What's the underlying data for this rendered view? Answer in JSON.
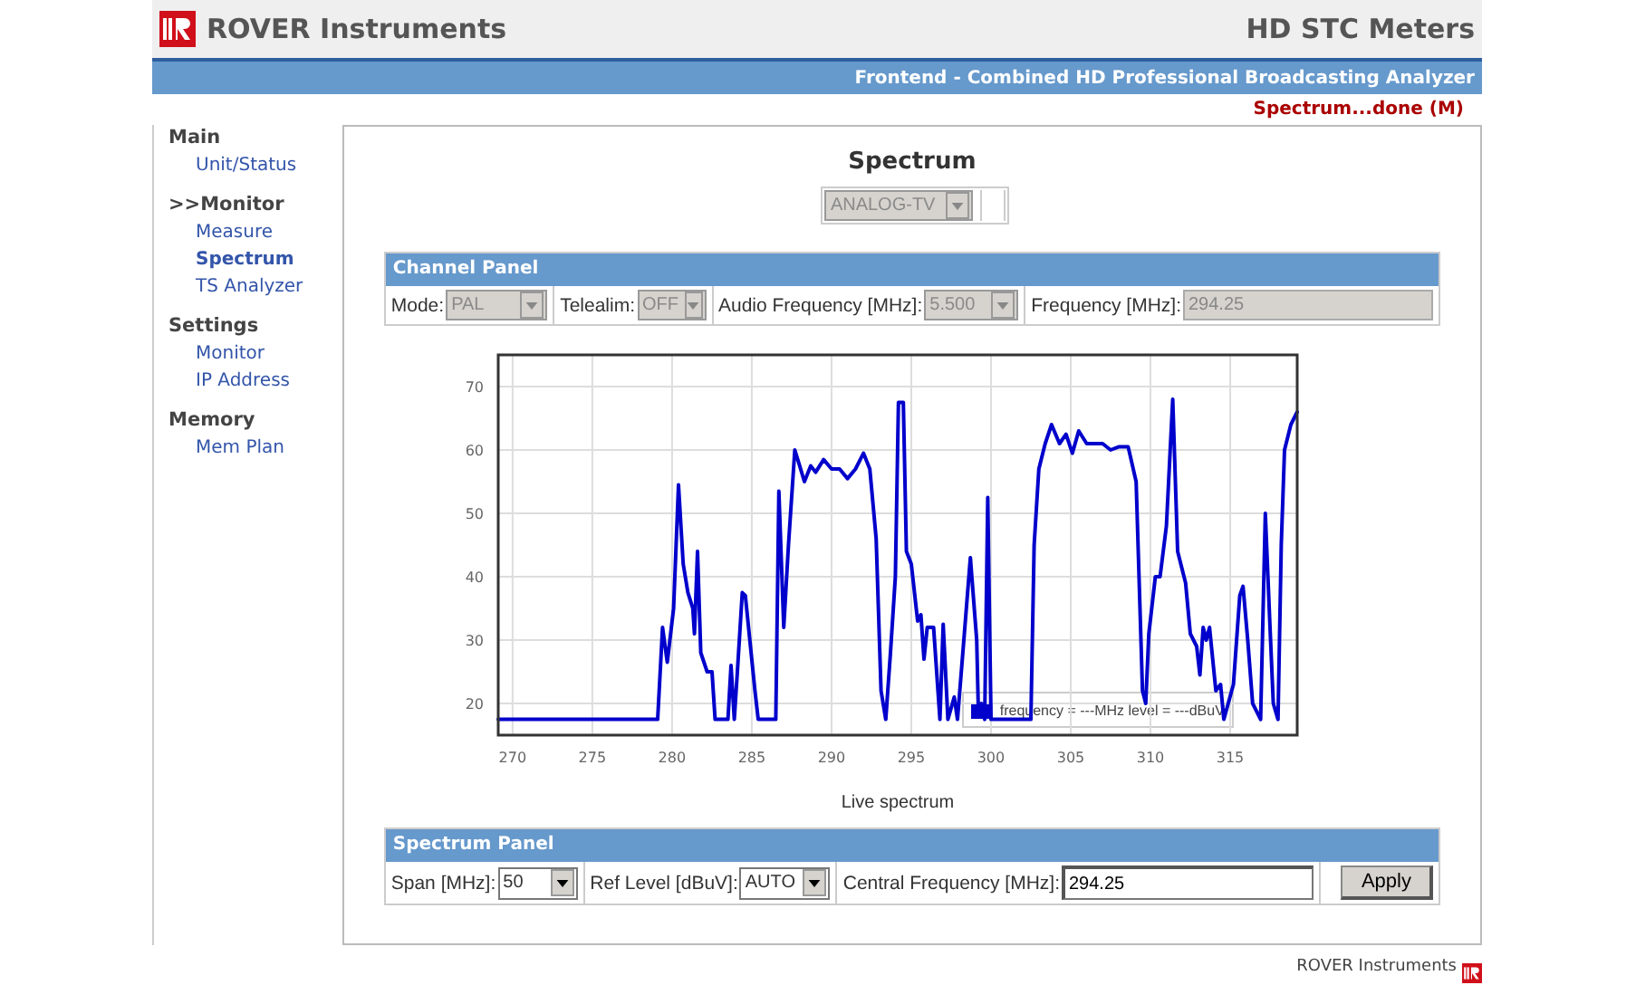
{
  "header": {
    "brand": "ROVER Instruments",
    "product": "HD STC Meters",
    "subtitle": "Frontend - Combined HD Professional Broadcasting Analyzer"
  },
  "status": "Spectrum...done (M)",
  "sidebar": {
    "groups": [
      {
        "title": "Main",
        "items": [
          {
            "label": "Unit/Status",
            "selected": false
          }
        ]
      },
      {
        "title": ">>Monitor",
        "items": [
          {
            "label": "Measure",
            "selected": false
          },
          {
            "label": "Spectrum",
            "selected": true
          },
          {
            "label": "TS Analyzer",
            "selected": false
          }
        ]
      },
      {
        "title": "Settings",
        "items": [
          {
            "label": "Monitor",
            "selected": false
          },
          {
            "label": "IP Address",
            "selected": false
          }
        ]
      },
      {
        "title": "Memory",
        "items": [
          {
            "label": "Mem Plan",
            "selected": false
          }
        ]
      }
    ]
  },
  "page_title": "Spectrum",
  "standard_select": {
    "value": "ANALOG-TV",
    "disabled": true
  },
  "channel_panel": {
    "title": "Channel Panel",
    "fields": [
      {
        "kind": "select",
        "label": "Mode:",
        "value": "PAL",
        "disabled": true
      },
      {
        "kind": "select",
        "label": "Telealim:",
        "value": "OFF",
        "disabled": true
      },
      {
        "kind": "select",
        "label": "Audio Frequency [MHz]:",
        "value": "5.500",
        "disabled": true
      },
      {
        "kind": "input",
        "label": "Frequency [MHz]:",
        "value": "294.25",
        "disabled": true
      }
    ]
  },
  "chart": {
    "chart_data": {
      "type": "line",
      "grid": true,
      "xlabel": "Live spectrum",
      "xlim": [
        269.1,
        319.2
      ],
      "ylim": [
        15,
        75
      ],
      "xticks": [
        270,
        275,
        280,
        285,
        290,
        295,
        300,
        305,
        310,
        315
      ],
      "yticks": [
        20,
        30,
        40,
        50,
        60,
        70
      ],
      "x": [
        269.1,
        279.1,
        279.4,
        279.7,
        280.1,
        280.4,
        280.7,
        281.0,
        281.3,
        281.4,
        281.6,
        281.8,
        282.2,
        282.5,
        282.7,
        283.5,
        283.7,
        283.9,
        284.1,
        284.4,
        284.6,
        285.2,
        285.4,
        286.5,
        286.7,
        287.0,
        287.3,
        287.7,
        288.0,
        288.3,
        288.7,
        289.0,
        289.5,
        290.0,
        290.5,
        291.0,
        291.5,
        292.0,
        292.4,
        292.8,
        293.1,
        293.4,
        293.7,
        294.0,
        294.2,
        294.5,
        294.7,
        295.0,
        295.4,
        295.6,
        295.8,
        296.0,
        296.4,
        296.8,
        297.0,
        297.3,
        297.7,
        297.9,
        298.3,
        298.7,
        299.1,
        299.2,
        299.4,
        299.6,
        299.8,
        300.0,
        302.5,
        302.7,
        303.0,
        303.4,
        303.8,
        304.3,
        304.7,
        305.1,
        305.5,
        306.0,
        306.5,
        307.0,
        307.5,
        308.0,
        308.6,
        309.1,
        309.5,
        309.7,
        309.9,
        310.3,
        310.6,
        311.0,
        311.4,
        311.7,
        312.2,
        312.5,
        312.9,
        313.1,
        313.3,
        313.5,
        313.7,
        314.1,
        314.4,
        314.6,
        315.2,
        315.6,
        315.8,
        316.1,
        316.4,
        316.9,
        317.2,
        317.5,
        317.7,
        318.0,
        318.2,
        318.4,
        318.8,
        319.2
      ],
      "series": [
        {
          "name": "frequency = ---MHz level = ---dBuV",
          "color": "#0000cc",
          "values": [
            17.5,
            17.5,
            32,
            26.5,
            35,
            54.5,
            42,
            37.5,
            35,
            31,
            44,
            28,
            25,
            25,
            17.5,
            17.5,
            26,
            17.5,
            25,
            37.5,
            37,
            22,
            17.5,
            17.5,
            53.5,
            32,
            45,
            60,
            57.5,
            55,
            57.5,
            56.5,
            58.5,
            57,
            57,
            55.5,
            57,
            59.5,
            57,
            46,
            22,
            17.5,
            28,
            40,
            67.5,
            67.5,
            44,
            42,
            33,
            34,
            27,
            32,
            32,
            17.5,
            32.5,
            17.5,
            21,
            17.5,
            30,
            43,
            30,
            19,
            20,
            17.5,
            52.5,
            17.5,
            17.5,
            45,
            57,
            61,
            64,
            61,
            62.5,
            59.5,
            63,
            61,
            61,
            61,
            60,
            60.5,
            60.5,
            55,
            22,
            20,
            31,
            40,
            40,
            48,
            68,
            44,
            39,
            31,
            29,
            24.5,
            32,
            30,
            32,
            22,
            23,
            17.5,
            23,
            37,
            38.5,
            30,
            20,
            17.5,
            50,
            32,
            20,
            17.5,
            45,
            60,
            64,
            66
          ]
        }
      ]
    }
  },
  "spectrum_panel": {
    "title": "Spectrum Panel",
    "fields": [
      {
        "kind": "select",
        "label": "Span [MHz]:",
        "value": "50",
        "disabled": false
      },
      {
        "kind": "select",
        "label": "Ref Level [dBuV]:",
        "value": "AUTO",
        "disabled": false
      },
      {
        "kind": "input",
        "label": "Central Frequency [MHz]:",
        "value": "294.25",
        "disabled": false
      },
      {
        "kind": "button",
        "label": "Apply",
        "disabled": false
      }
    ]
  },
  "footer": {
    "brand": "ROVER Instruments"
  }
}
